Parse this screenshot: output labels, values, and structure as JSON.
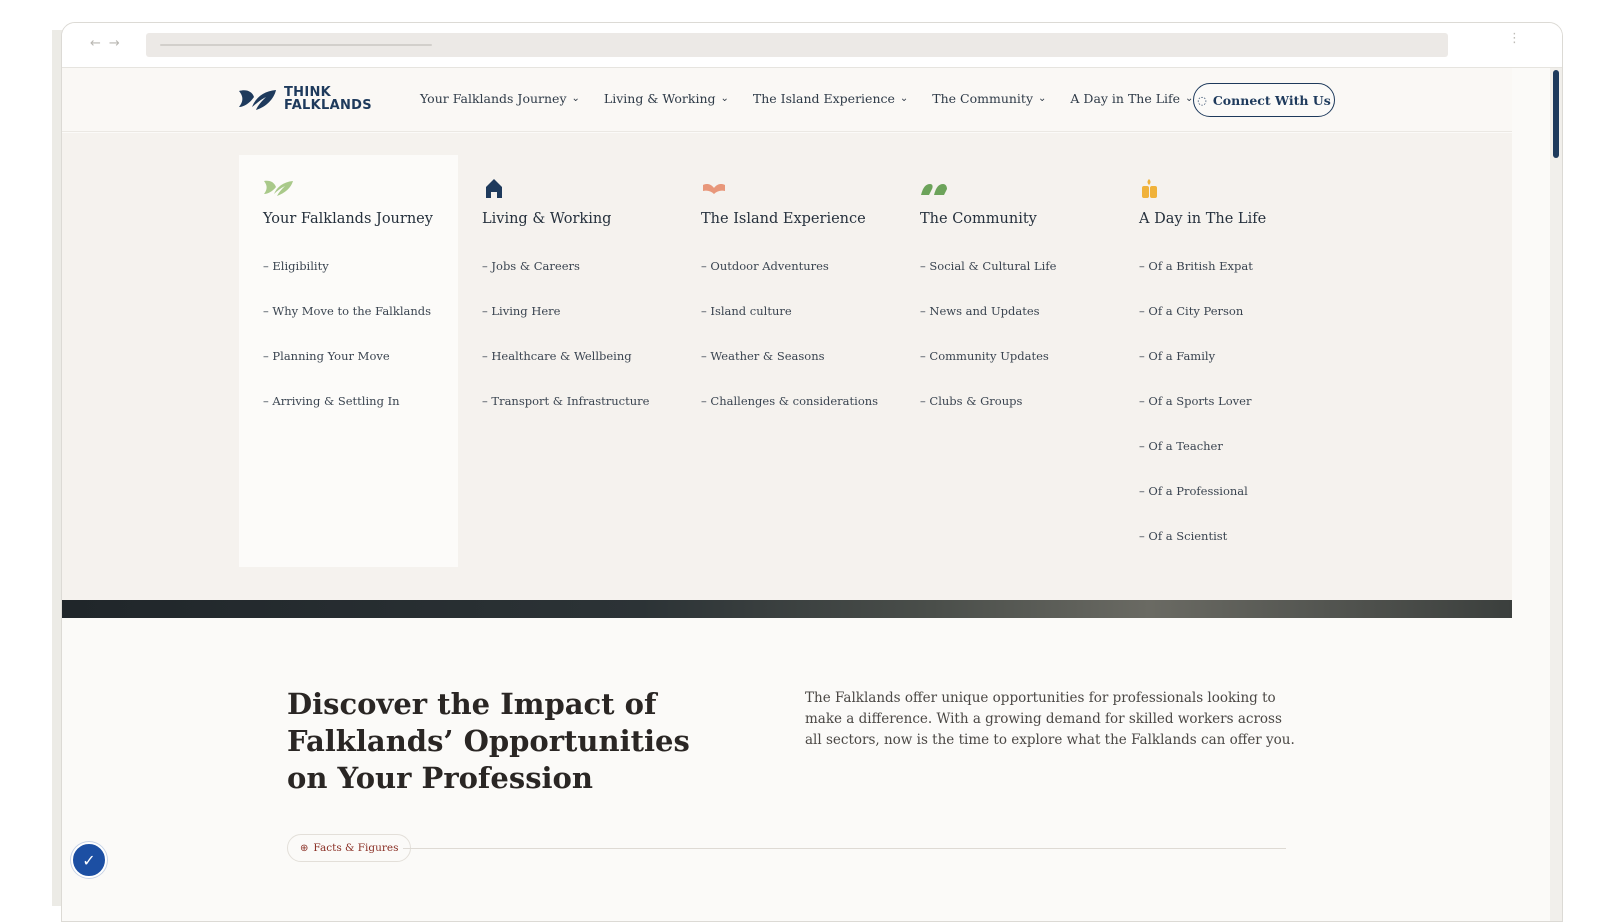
{
  "browser": {
    "back_icon": "←",
    "forward_icon": "→",
    "menu_icon": "⋮"
  },
  "header": {
    "logo_line1": "THINK",
    "logo_line2": "FALKLANDS",
    "nav": [
      {
        "label": "Your Falklands Journey"
      },
      {
        "label": "Living & Working"
      },
      {
        "label": "The Island Experience"
      },
      {
        "label": "The Community"
      },
      {
        "label": "A Day in The Life"
      }
    ],
    "chevron": "⌄",
    "connect_label": "Connect With Us",
    "connect_icon": "◌"
  },
  "mega_menu": {
    "columns": [
      {
        "icon": "leaf-icon",
        "title": "Your Falklands Journey",
        "links": [
          "– Eligibility",
          "– Why Move to the Falklands",
          "– Planning Your Move",
          "– Arriving & Settling In"
        ]
      },
      {
        "icon": "house-icon",
        "title": "Living & Working",
        "links": [
          "– Jobs & Careers",
          "– Living Here",
          "– Healthcare & Wellbeing",
          "– Transport & Infrastructure"
        ]
      },
      {
        "icon": "book-icon",
        "title": "The Island Experience",
        "links": [
          "– Outdoor Adventures",
          "– Island culture",
          "– Weather & Seasons",
          "– Challenges & considerations"
        ]
      },
      {
        "icon": "people-icon",
        "title": "The Community",
        "links": [
          "– Social & Cultural Life",
          "– News and Updates",
          "– Community Updates",
          "– Clubs & Groups"
        ]
      },
      {
        "icon": "sun-icon",
        "title": "A Day in The Life",
        "links": [
          "– Of a British Expat",
          "– Of a City Person",
          "– Of a Family",
          "– Of a Sports Lover",
          "– Of a Teacher",
          "– Of a Professional",
          "– Of a Scientist"
        ]
      }
    ],
    "icon_colors": {
      "leaf": "#a9c98a",
      "house": "#1e3a5c",
      "book": "#e8977a",
      "people": "#6ca35a",
      "sun": "#f0b23a"
    }
  },
  "content": {
    "headline": "Discover the Impact of Falklands’ Opportunities on Your Profession",
    "intro": "The Falklands offer unique opportunities for professionals looking to make a difference. With a growing demand for skilled workers across all sectors, now is the time to explore what the Falklands can offer you.",
    "badge_label": "Facts & Figures",
    "badge_icon": "⊕"
  },
  "accessibility": {
    "icon": "✓"
  },
  "colors": {
    "brand_navy": "#1e3a5c",
    "badge_red": "#8a2f25",
    "a11y_blue": "#1c4fa3"
  }
}
